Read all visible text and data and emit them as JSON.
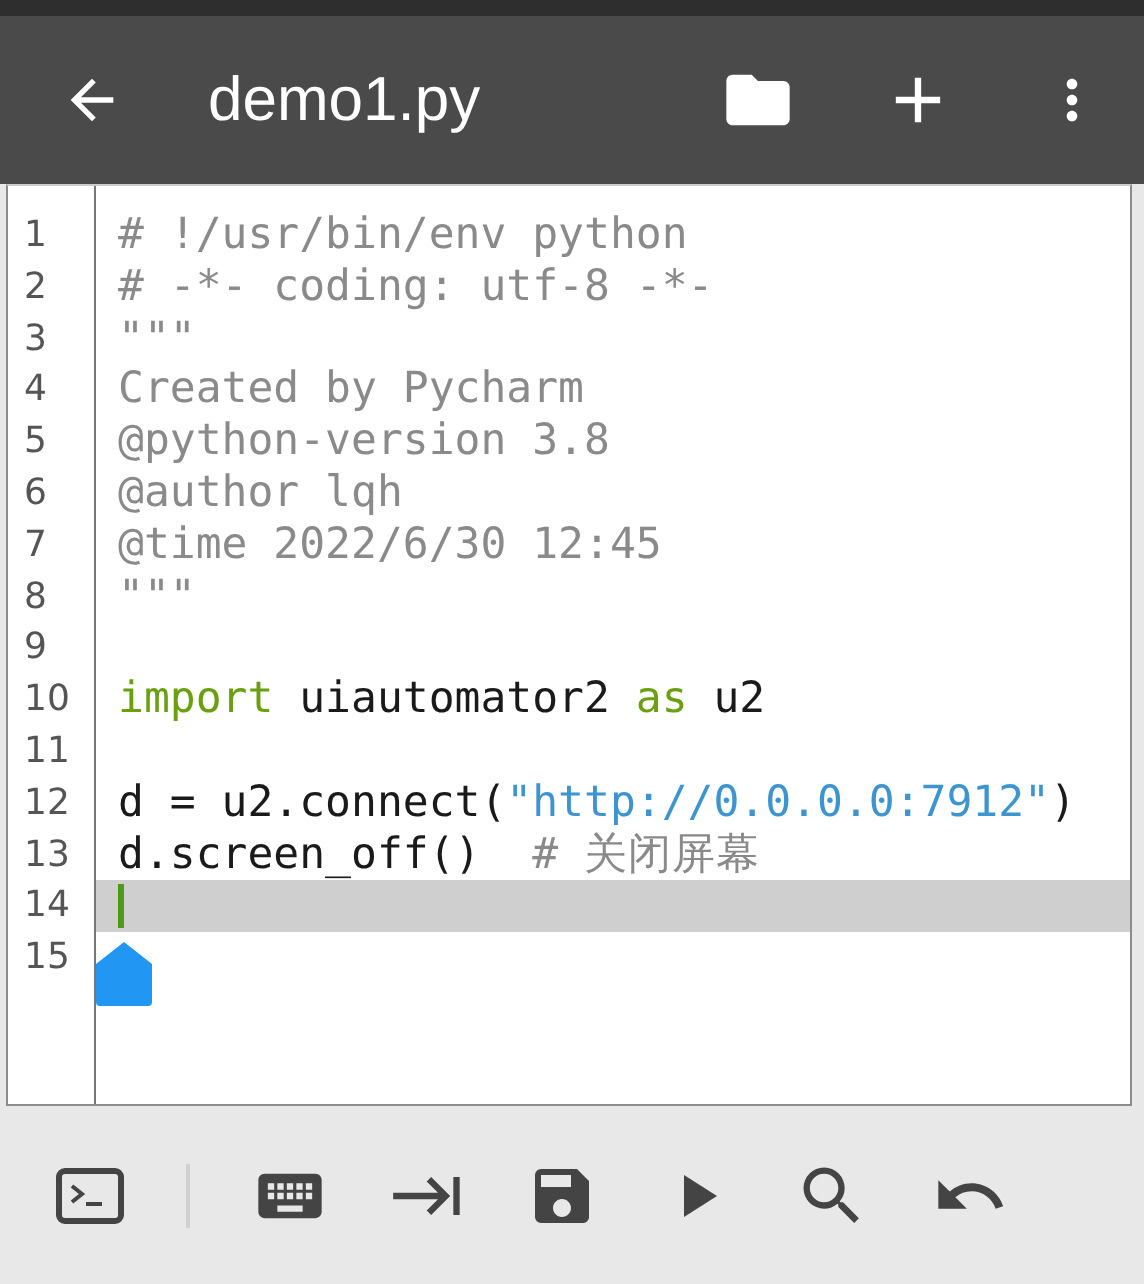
{
  "app_bar": {
    "title": "demo1.py"
  },
  "editor": {
    "lines": [
      {
        "number": "1",
        "current": false,
        "tokens": [
          {
            "kind": "comment",
            "text": "# !/usr/bin/env python"
          }
        ]
      },
      {
        "number": "2",
        "current": false,
        "tokens": [
          {
            "kind": "comment",
            "text": "# -*- coding: utf-8 -*-"
          }
        ]
      },
      {
        "number": "3",
        "current": false,
        "tokens": [
          {
            "kind": "comment",
            "text": "\"\"\""
          }
        ]
      },
      {
        "number": "4",
        "current": false,
        "tokens": [
          {
            "kind": "comment",
            "text": "Created by Pycharm"
          }
        ]
      },
      {
        "number": "5",
        "current": false,
        "tokens": [
          {
            "kind": "comment",
            "text": "@python-version 3.8"
          }
        ]
      },
      {
        "number": "6",
        "current": false,
        "tokens": [
          {
            "kind": "comment",
            "text": "@author lqh"
          }
        ]
      },
      {
        "number": "7",
        "current": false,
        "tokens": [
          {
            "kind": "comment",
            "text": "@time 2022/6/30 12:45"
          }
        ]
      },
      {
        "number": "8",
        "current": false,
        "tokens": [
          {
            "kind": "comment",
            "text": "\"\"\""
          }
        ]
      },
      {
        "number": "9",
        "current": false
      },
      {
        "number": "10",
        "current": false,
        "tokens": [
          {
            "kind": "keyword",
            "text": "import"
          },
          {
            "kind": "plain",
            "text": " uiautomator2 "
          },
          {
            "kind": "keyword",
            "text": "as"
          },
          {
            "kind": "plain",
            "text": " u2"
          }
        ]
      },
      {
        "number": "11",
        "current": false
      },
      {
        "number": "12",
        "current": false,
        "tokens": [
          {
            "kind": "plain",
            "text": "d = u2.connect("
          },
          {
            "kind": "string",
            "text": "\"http://0.0.0.0:7912\""
          },
          {
            "kind": "plain",
            "text": ")"
          }
        ]
      },
      {
        "number": "13",
        "current": false,
        "tokens": [
          {
            "kind": "plain",
            "text": "d.screen_off()  "
          },
          {
            "kind": "comment",
            "text": "# 关闭屏幕"
          }
        ]
      },
      {
        "number": "14",
        "current": true
      },
      {
        "number": "15",
        "current": false
      }
    ]
  }
}
